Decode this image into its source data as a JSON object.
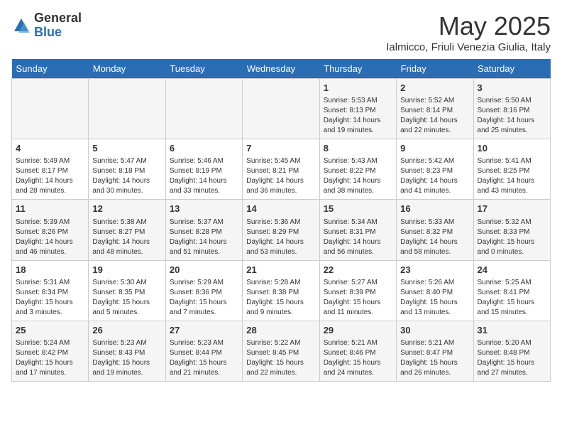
{
  "header": {
    "logo_general": "General",
    "logo_blue": "Blue",
    "month_title": "May 2025",
    "subtitle": "Ialmicco, Friuli Venezia Giulia, Italy"
  },
  "weekdays": [
    "Sunday",
    "Monday",
    "Tuesday",
    "Wednesday",
    "Thursday",
    "Friday",
    "Saturday"
  ],
  "weeks": [
    [
      {
        "day": "",
        "info": ""
      },
      {
        "day": "",
        "info": ""
      },
      {
        "day": "",
        "info": ""
      },
      {
        "day": "",
        "info": ""
      },
      {
        "day": "1",
        "info": "Sunrise: 5:53 AM\nSunset: 8:13 PM\nDaylight: 14 hours\nand 19 minutes."
      },
      {
        "day": "2",
        "info": "Sunrise: 5:52 AM\nSunset: 8:14 PM\nDaylight: 14 hours\nand 22 minutes."
      },
      {
        "day": "3",
        "info": "Sunrise: 5:50 AM\nSunset: 8:16 PM\nDaylight: 14 hours\nand 25 minutes."
      }
    ],
    [
      {
        "day": "4",
        "info": "Sunrise: 5:49 AM\nSunset: 8:17 PM\nDaylight: 14 hours\nand 28 minutes."
      },
      {
        "day": "5",
        "info": "Sunrise: 5:47 AM\nSunset: 8:18 PM\nDaylight: 14 hours\nand 30 minutes."
      },
      {
        "day": "6",
        "info": "Sunrise: 5:46 AM\nSunset: 8:19 PM\nDaylight: 14 hours\nand 33 minutes."
      },
      {
        "day": "7",
        "info": "Sunrise: 5:45 AM\nSunset: 8:21 PM\nDaylight: 14 hours\nand 36 minutes."
      },
      {
        "day": "8",
        "info": "Sunrise: 5:43 AM\nSunset: 8:22 PM\nDaylight: 14 hours\nand 38 minutes."
      },
      {
        "day": "9",
        "info": "Sunrise: 5:42 AM\nSunset: 8:23 PM\nDaylight: 14 hours\nand 41 minutes."
      },
      {
        "day": "10",
        "info": "Sunrise: 5:41 AM\nSunset: 8:25 PM\nDaylight: 14 hours\nand 43 minutes."
      }
    ],
    [
      {
        "day": "11",
        "info": "Sunrise: 5:39 AM\nSunset: 8:26 PM\nDaylight: 14 hours\nand 46 minutes."
      },
      {
        "day": "12",
        "info": "Sunrise: 5:38 AM\nSunset: 8:27 PM\nDaylight: 14 hours\nand 48 minutes."
      },
      {
        "day": "13",
        "info": "Sunrise: 5:37 AM\nSunset: 8:28 PM\nDaylight: 14 hours\nand 51 minutes."
      },
      {
        "day": "14",
        "info": "Sunrise: 5:36 AM\nSunset: 8:29 PM\nDaylight: 14 hours\nand 53 minutes."
      },
      {
        "day": "15",
        "info": "Sunrise: 5:34 AM\nSunset: 8:31 PM\nDaylight: 14 hours\nand 56 minutes."
      },
      {
        "day": "16",
        "info": "Sunrise: 5:33 AM\nSunset: 8:32 PM\nDaylight: 14 hours\nand 58 minutes."
      },
      {
        "day": "17",
        "info": "Sunrise: 5:32 AM\nSunset: 8:33 PM\nDaylight: 15 hours\nand 0 minutes."
      }
    ],
    [
      {
        "day": "18",
        "info": "Sunrise: 5:31 AM\nSunset: 8:34 PM\nDaylight: 15 hours\nand 3 minutes."
      },
      {
        "day": "19",
        "info": "Sunrise: 5:30 AM\nSunset: 8:35 PM\nDaylight: 15 hours\nand 5 minutes."
      },
      {
        "day": "20",
        "info": "Sunrise: 5:29 AM\nSunset: 8:36 PM\nDaylight: 15 hours\nand 7 minutes."
      },
      {
        "day": "21",
        "info": "Sunrise: 5:28 AM\nSunset: 8:38 PM\nDaylight: 15 hours\nand 9 minutes."
      },
      {
        "day": "22",
        "info": "Sunrise: 5:27 AM\nSunset: 8:39 PM\nDaylight: 15 hours\nand 11 minutes."
      },
      {
        "day": "23",
        "info": "Sunrise: 5:26 AM\nSunset: 8:40 PM\nDaylight: 15 hours\nand 13 minutes."
      },
      {
        "day": "24",
        "info": "Sunrise: 5:25 AM\nSunset: 8:41 PM\nDaylight: 15 hours\nand 15 minutes."
      }
    ],
    [
      {
        "day": "25",
        "info": "Sunrise: 5:24 AM\nSunset: 8:42 PM\nDaylight: 15 hours\nand 17 minutes."
      },
      {
        "day": "26",
        "info": "Sunrise: 5:23 AM\nSunset: 8:43 PM\nDaylight: 15 hours\nand 19 minutes."
      },
      {
        "day": "27",
        "info": "Sunrise: 5:23 AM\nSunset: 8:44 PM\nDaylight: 15 hours\nand 21 minutes."
      },
      {
        "day": "28",
        "info": "Sunrise: 5:22 AM\nSunset: 8:45 PM\nDaylight: 15 hours\nand 22 minutes."
      },
      {
        "day": "29",
        "info": "Sunrise: 5:21 AM\nSunset: 8:46 PM\nDaylight: 15 hours\nand 24 minutes."
      },
      {
        "day": "30",
        "info": "Sunrise: 5:21 AM\nSunset: 8:47 PM\nDaylight: 15 hours\nand 26 minutes."
      },
      {
        "day": "31",
        "info": "Sunrise: 5:20 AM\nSunset: 8:48 PM\nDaylight: 15 hours\nand 27 minutes."
      }
    ]
  ]
}
